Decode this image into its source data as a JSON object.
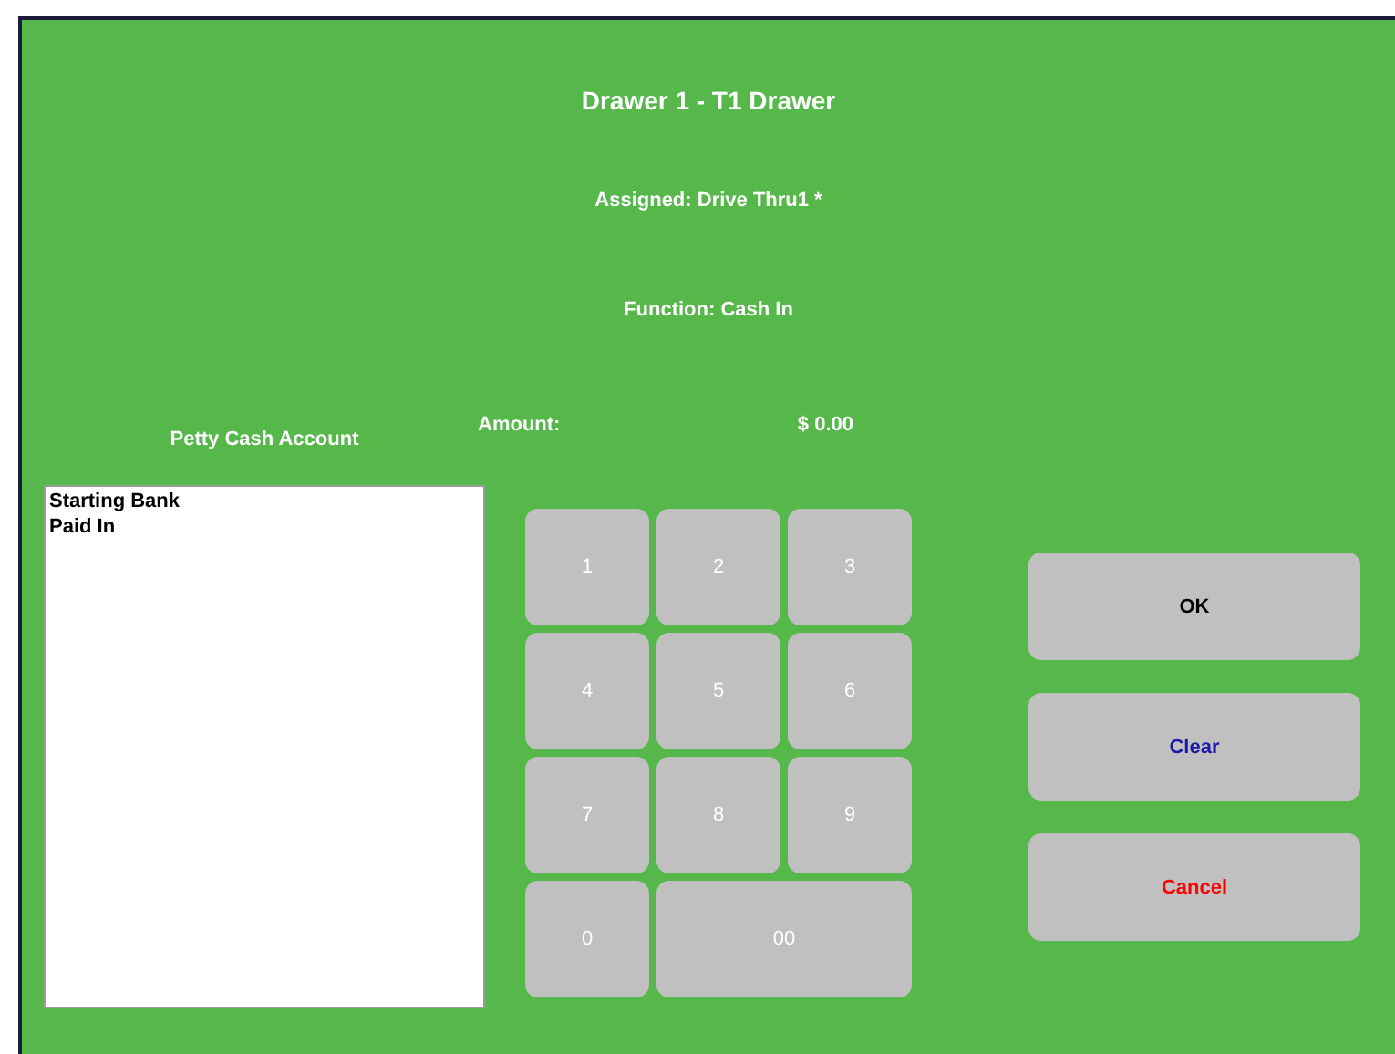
{
  "title": "Drawer 1 - T1 Drawer",
  "assigned": "Assigned: Drive Thru1 *",
  "function": "Function: Cash In",
  "account_label": "Petty Cash Account",
  "accounts": [
    "Starting Bank",
    "Paid In"
  ],
  "amount": {
    "label": "Amount:",
    "value": "$ 0.00"
  },
  "keypad": [
    {
      "label": "1",
      "kind": "single"
    },
    {
      "label": "2",
      "kind": "single"
    },
    {
      "label": "3",
      "kind": "single"
    },
    {
      "label": "4",
      "kind": "single"
    },
    {
      "label": "5",
      "kind": "single"
    },
    {
      "label": "6",
      "kind": "single"
    },
    {
      "label": "7",
      "kind": "single"
    },
    {
      "label": "8",
      "kind": "single"
    },
    {
      "label": "9",
      "kind": "single"
    },
    {
      "label": "0",
      "kind": "single"
    },
    {
      "label": "00",
      "kind": "wide"
    }
  ],
  "actions": [
    {
      "label": "OK",
      "color": "#000000"
    },
    {
      "label": "Clear",
      "color": "#1a1aa8"
    },
    {
      "label": "Cancel",
      "color": "#ff0000"
    }
  ]
}
